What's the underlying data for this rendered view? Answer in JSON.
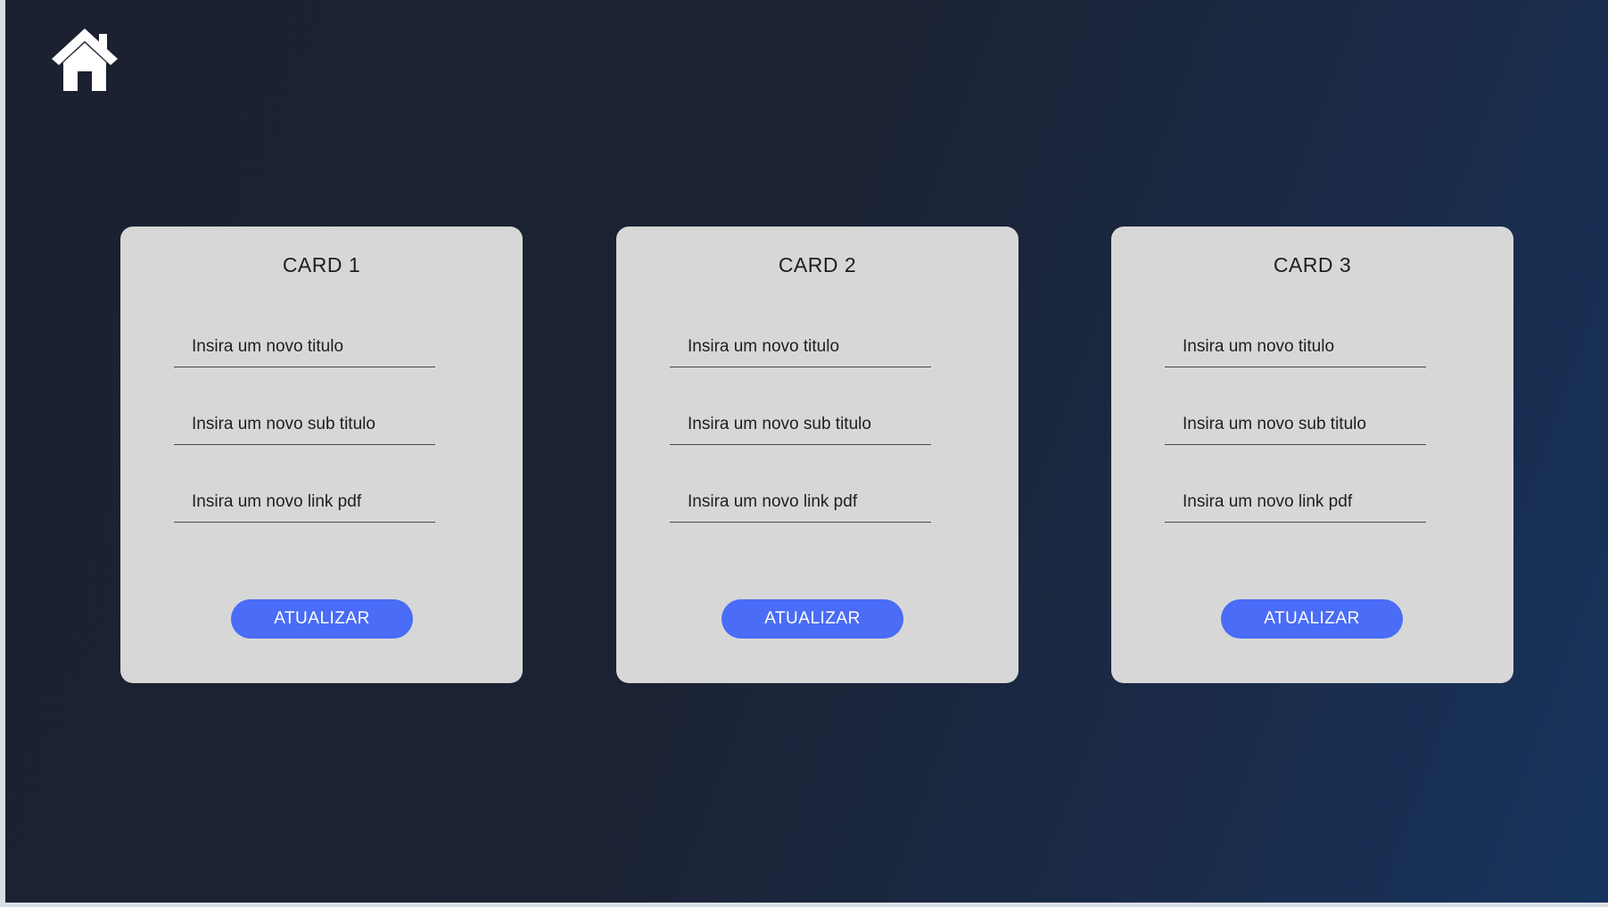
{
  "header": {
    "home_icon": "home-icon"
  },
  "colors": {
    "background_start": "#1b2130",
    "background_end": "#17345e",
    "card_background": "#d7d7d7",
    "button_accent": "#4a6cf6",
    "button_text": "#ffffff"
  },
  "cards": [
    {
      "title": "CARD 1",
      "title_placeholder": "Insira um novo titulo",
      "subtitle_placeholder": "Insira um novo sub titulo",
      "pdf_placeholder": "Insira um novo link pdf",
      "button_label": "ATUALIZAR"
    },
    {
      "title": "CARD 2",
      "title_placeholder": "Insira um novo titulo",
      "subtitle_placeholder": "Insira um novo sub titulo",
      "pdf_placeholder": "Insira um novo link pdf",
      "button_label": "ATUALIZAR"
    },
    {
      "title": "CARD 3",
      "title_placeholder": "Insira um novo titulo",
      "subtitle_placeholder": "Insira um novo sub titulo",
      "pdf_placeholder": "Insira um novo link pdf",
      "button_label": "ATUALIZAR"
    }
  ]
}
